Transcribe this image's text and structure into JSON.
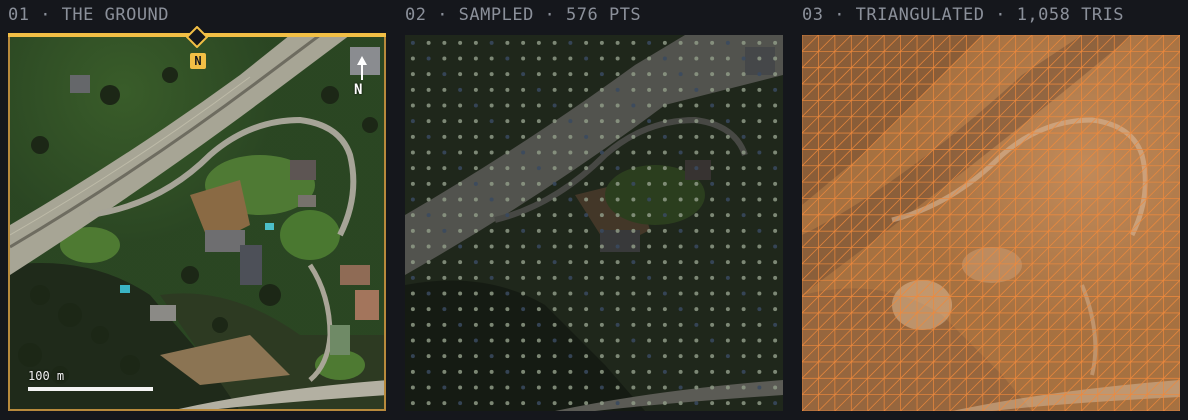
{
  "panels": [
    {
      "title": "01 · THE GROUND"
    },
    {
      "title": "02 · SAMPLED  ·  576 PTS"
    },
    {
      "title": "03 · TRIANGULATED  ·  1,058 TRIS"
    }
  ],
  "map": {
    "north_marker_label": "N",
    "compass_label": "N",
    "scale_label": "100 m"
  },
  "sampling": {
    "grid": 24,
    "points": 576
  },
  "mesh": {
    "grid": 23,
    "triangles": 1058
  },
  "colors": {
    "accent": "#f2bf45",
    "background": "#15171c",
    "title_text": "#8b909a",
    "mesh_line": "#f08a3c",
    "terrain_tint": "#c98a55"
  }
}
